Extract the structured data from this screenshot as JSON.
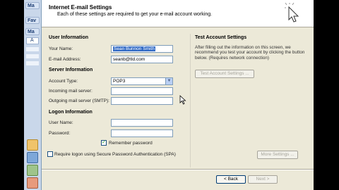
{
  "outlook": {
    "tabs": [
      "Ma",
      "Fav",
      "Ma"
    ],
    "item_letter": "A"
  },
  "dialog": {
    "title": "Internet E-mail Settings",
    "subtitle": "Each of these settings are required to get your e-mail account working."
  },
  "user_info": {
    "heading": "User Information",
    "your_name_label": "Your Name:",
    "your_name_value": "Sean Bunnon Smith",
    "email_label": "E-mail Address:",
    "email_value": "seanb@tld.com"
  },
  "server_info": {
    "heading": "Server Information",
    "account_type_label": "Account Type:",
    "account_type_value": "POP3",
    "incoming_label": "Incoming mail server:",
    "incoming_value": "",
    "outgoing_label": "Outgoing mail server (SMTP):",
    "outgoing_value": ""
  },
  "logon_info": {
    "heading": "Logon Information",
    "user_name_label": "User Name:",
    "user_name_value": "",
    "password_label": "Password:",
    "password_value": "",
    "remember_label": "Remember password",
    "remember_checked": true,
    "spa_label": "Require logon using Secure Password Authentication (SPA)",
    "spa_checked": false
  },
  "test_settings": {
    "heading": "Test Account Settings",
    "description": "After filling out the information on this screen, we recommend you test your account by clicking the button below. (Requires network connection)",
    "test_button": "Test Account Settings ...",
    "more_settings_button": "More Settings ..."
  },
  "footer": {
    "back_button": "< Back",
    "next_button": "Next >"
  },
  "colors": {
    "dialog_bg": "#ece9d8",
    "header_bg": "#ffffff",
    "selection": "#316ac5",
    "field_border": "#7f9db9"
  }
}
